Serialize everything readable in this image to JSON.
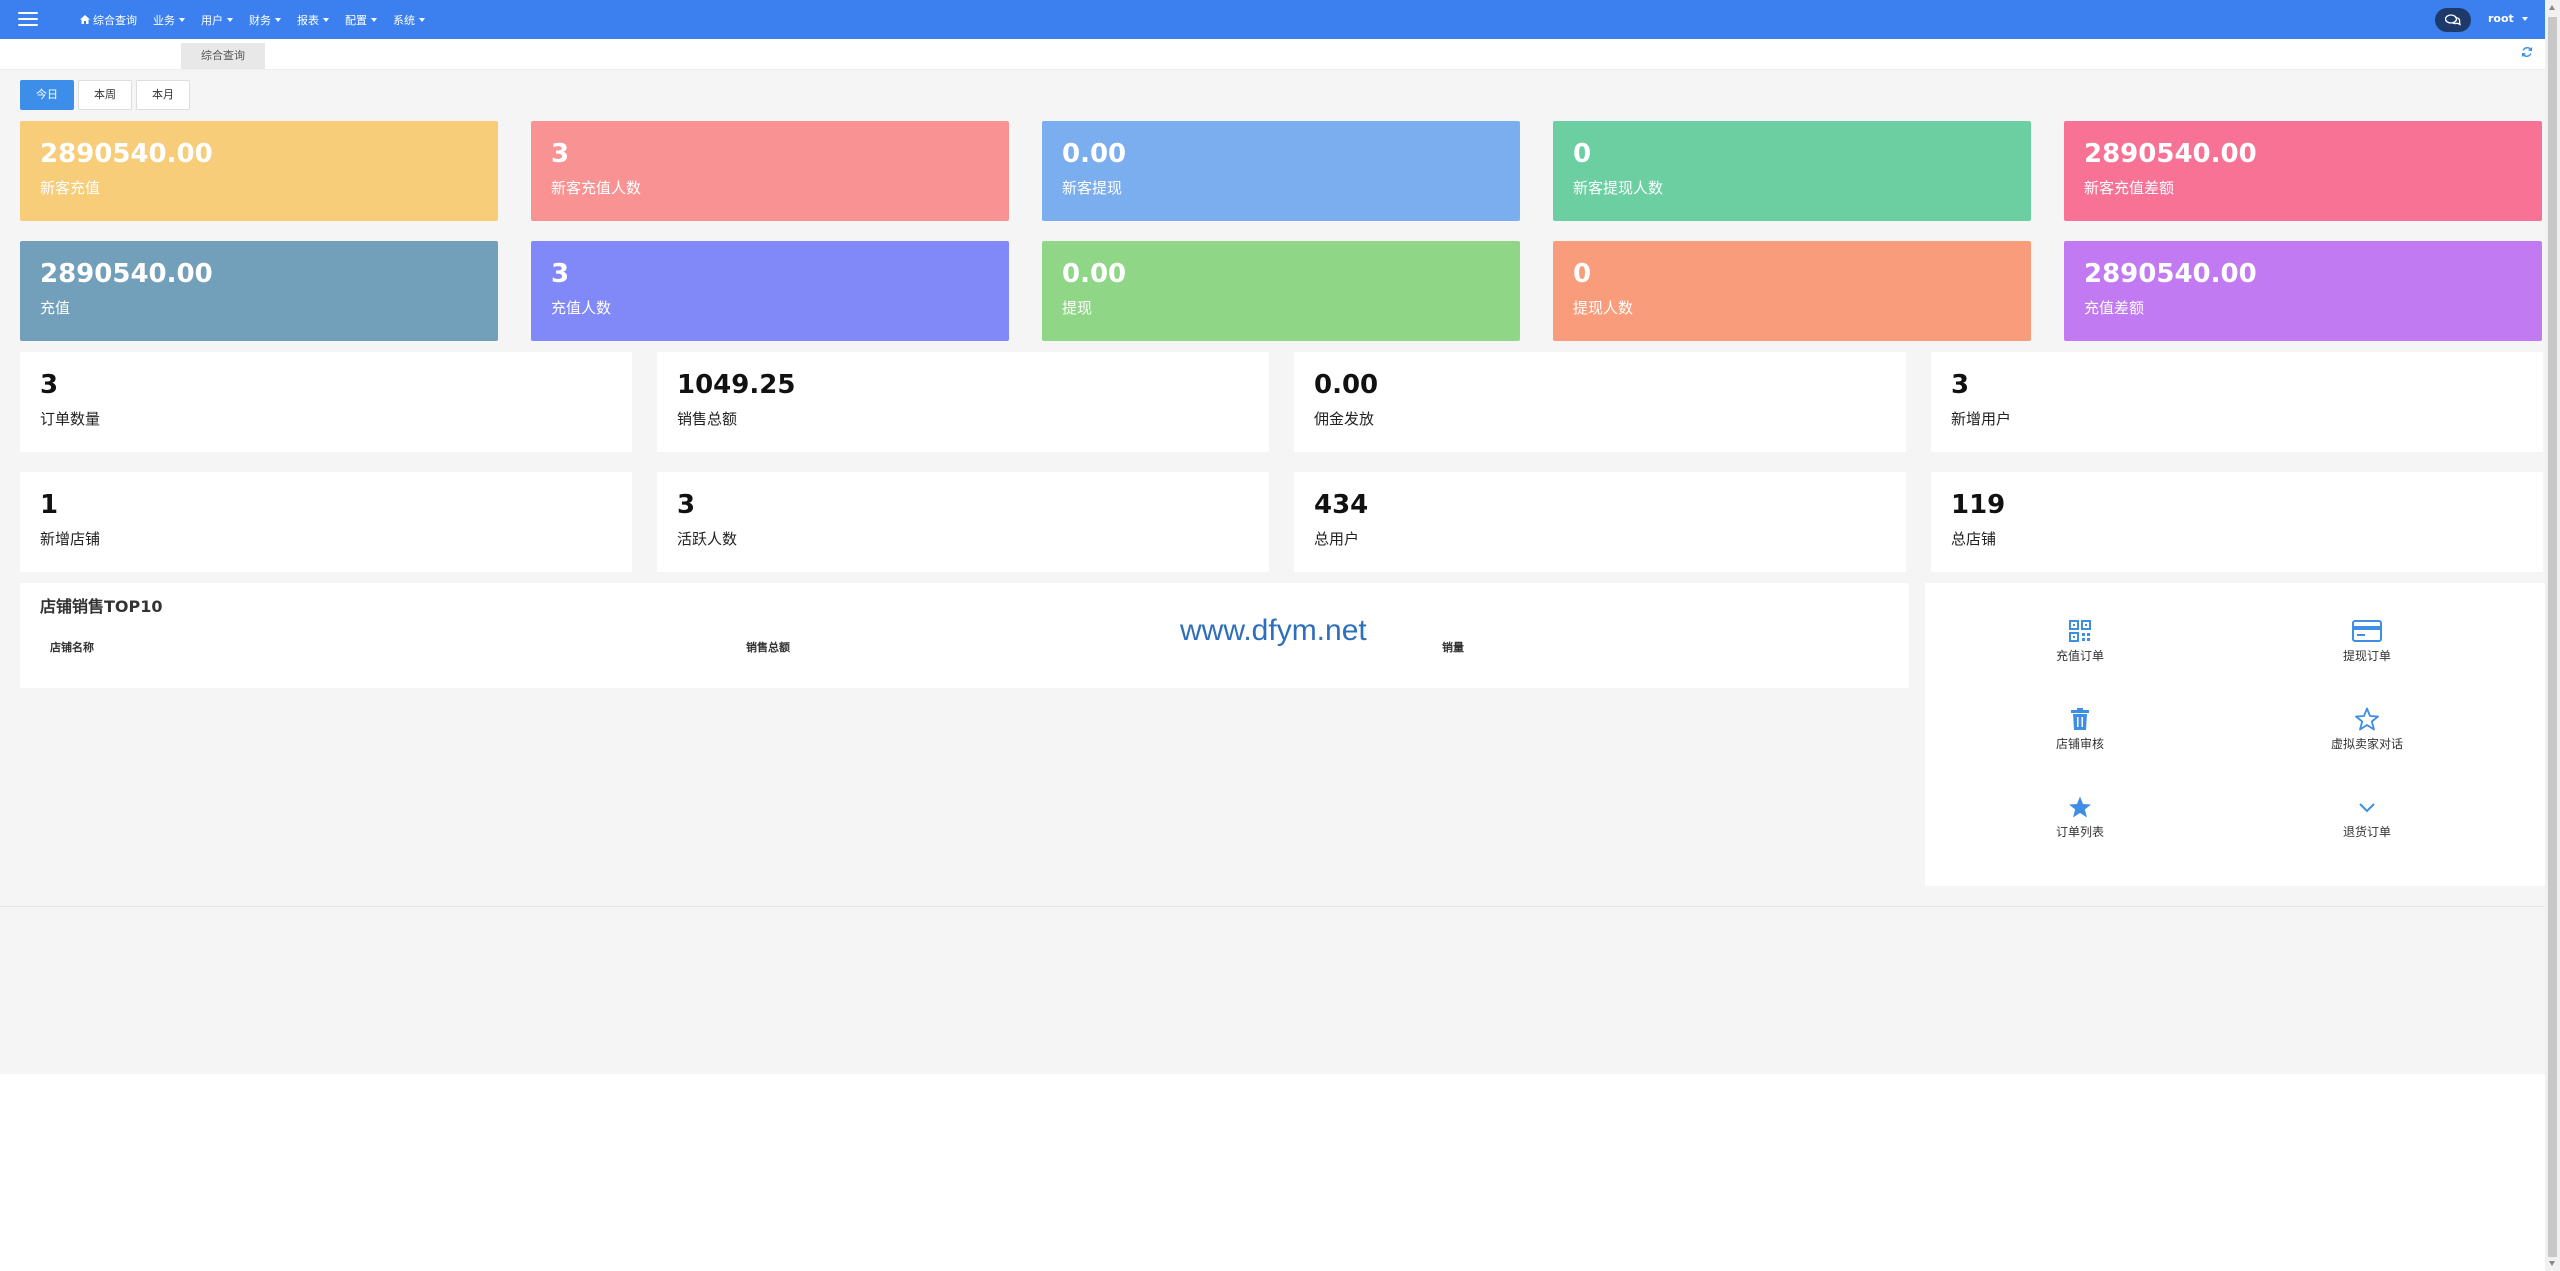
{
  "topnav": {
    "home": "综合查询",
    "menus": [
      "业务",
      "用户",
      "财务",
      "报表",
      "配置",
      "系统"
    ]
  },
  "user": {
    "name": "root"
  },
  "tabs": {
    "active": "综合查询"
  },
  "periods": [
    "今日",
    "本周",
    "本月"
  ],
  "cards_row1": [
    {
      "value": "2890540.00",
      "label": "新客充值",
      "color": "#f7cd79"
    },
    {
      "value": "3",
      "label": "新客充值人数",
      "color": "#f99393"
    },
    {
      "value": "0.00",
      "label": "新客提现",
      "color": "#7aaeee"
    },
    {
      "value": "0",
      "label": "新客提现人数",
      "color": "#6bcfa2"
    },
    {
      "value": "2890540.00",
      "label": "新客充值差额",
      "color": "#f77295"
    }
  ],
  "cards_row2": [
    {
      "value": "2890540.00",
      "label": "充值",
      "color": "#729fba"
    },
    {
      "value": "3",
      "label": "充值人数",
      "color": "#8189f9"
    },
    {
      "value": "0.00",
      "label": "提现",
      "color": "#8fd786"
    },
    {
      "value": "0",
      "label": "提现人数",
      "color": "#f89c7c"
    },
    {
      "value": "2890540.00",
      "label": "充值差额",
      "color": "#c27af3"
    }
  ],
  "stats_row1": [
    {
      "value": "3",
      "label": "订单数量"
    },
    {
      "value": "1049.25",
      "label": "销售总额"
    },
    {
      "value": "0.00",
      "label": "佣金发放"
    },
    {
      "value": "3",
      "label": "新增用户"
    }
  ],
  "stats_row2": [
    {
      "value": "1",
      "label": "新增店铺"
    },
    {
      "value": "3",
      "label": "活跃人数"
    },
    {
      "value": "434",
      "label": "总用户"
    },
    {
      "value": "119",
      "label": "总店铺"
    }
  ],
  "top10": {
    "title": "店铺销售TOP10",
    "columns": [
      "店铺名称",
      "销售总额",
      "销量"
    ]
  },
  "watermark": "www.dfym.net",
  "shortcuts": [
    {
      "label": "充值订单",
      "icon": "qrcode-icon"
    },
    {
      "label": "提现订单",
      "icon": "credit-card-icon"
    },
    {
      "label": "店铺审核",
      "icon": "trash-icon"
    },
    {
      "label": "虚拟卖家对话",
      "icon": "star-outline-icon"
    },
    {
      "label": "订单列表",
      "icon": "star-filled-icon"
    },
    {
      "label": "退货订单",
      "icon": "chevron-down-icon"
    }
  ],
  "colors": {
    "topbar": "#3c80ef",
    "accent": "#3c8ee8",
    "icon": "#3e8ee6"
  }
}
